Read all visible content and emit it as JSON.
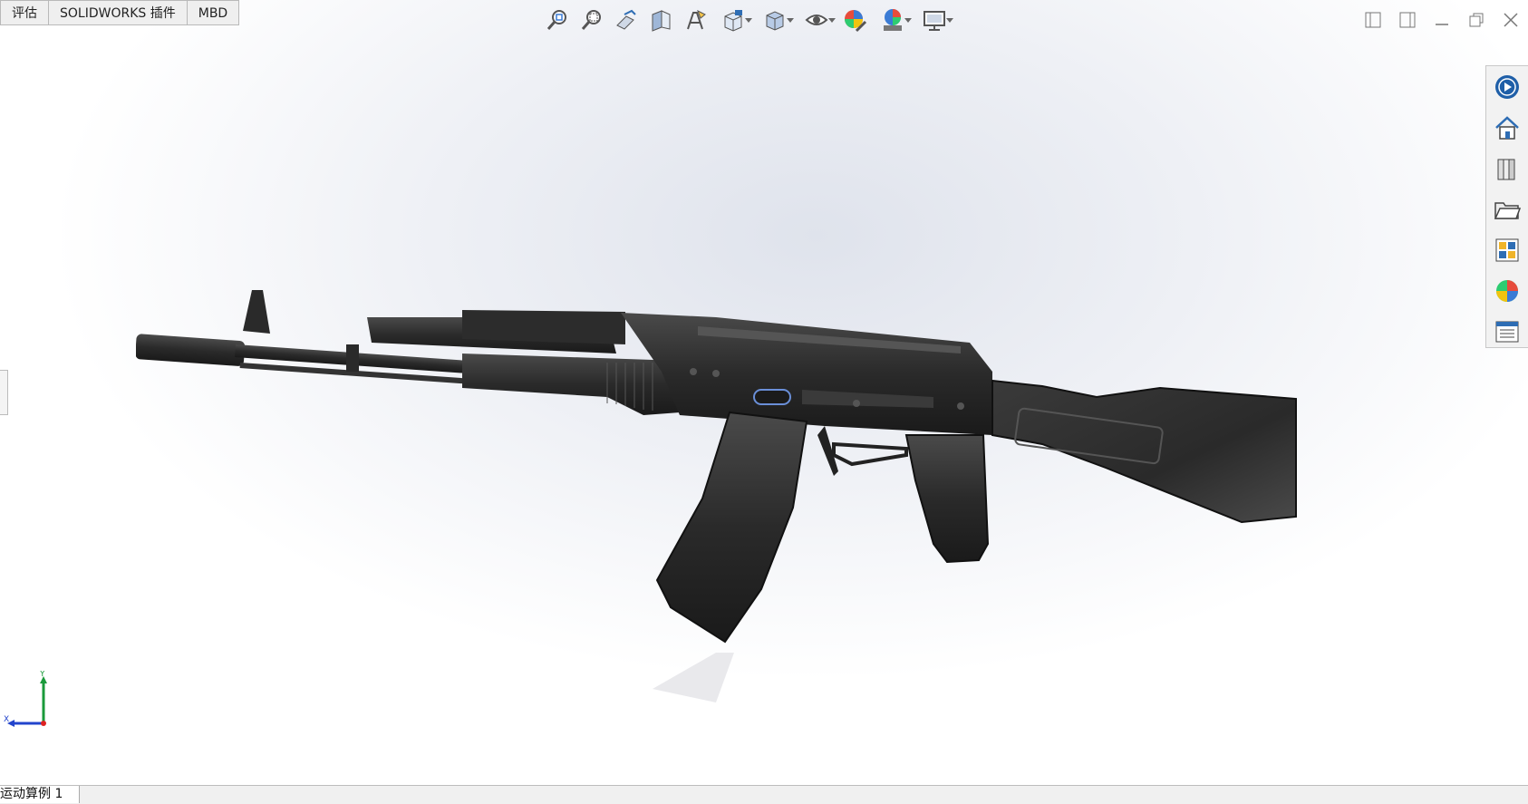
{
  "command_tabs": [
    "评估",
    "SOLIDWORKS 插件",
    "MBD"
  ],
  "hud_toolbar": [
    {
      "name": "zoom-to-fit-icon",
      "drop": false
    },
    {
      "name": "zoom-to-area-icon",
      "drop": false
    },
    {
      "name": "previous-view-icon",
      "drop": false
    },
    {
      "name": "section-view-icon",
      "drop": false
    },
    {
      "name": "dynamic-annotation-views-icon",
      "drop": false
    },
    {
      "name": "view-orientation-icon",
      "drop": true
    },
    {
      "name": "display-style-icon",
      "drop": true
    },
    {
      "name": "hide-show-items-icon",
      "drop": true
    },
    {
      "name": "edit-appearance-icon",
      "drop": false
    },
    {
      "name": "apply-scene-icon",
      "drop": true
    },
    {
      "name": "view-settings-icon",
      "drop": true
    }
  ],
  "window_controls": [
    "tile-left-icon",
    "tile-right-icon",
    "minimize-icon",
    "restore-icon",
    "close-icon"
  ],
  "task_pane": [
    "solidworks-resources-icon",
    "home-icon",
    "design-library-icon",
    "file-explorer-icon",
    "view-palette-icon",
    "appearances-icon",
    "custom-properties-icon"
  ],
  "triad": {
    "y_label": "Y",
    "x_label": "X"
  },
  "bottom_tab": "运动算例 1",
  "colors": {
    "accent": "#2e6db4",
    "model": "#2b2b2b"
  }
}
